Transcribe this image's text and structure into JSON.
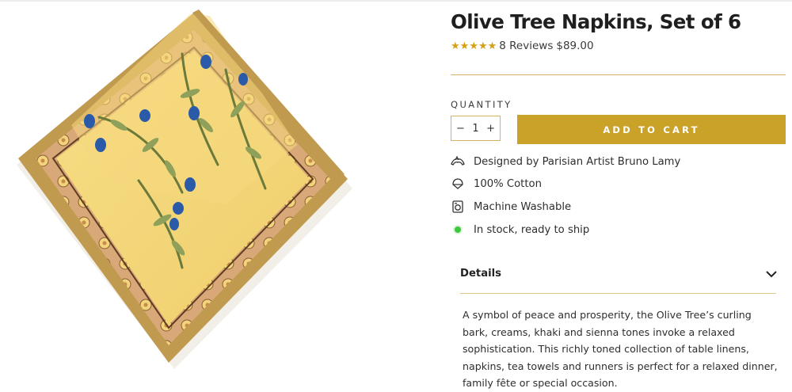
{
  "product": {
    "title": "Olive Tree Napkins, Set of 6",
    "rating_stars": 5,
    "reviews": "8 Reviews",
    "price": "$89.00",
    "image_icon": "napkin-product-image",
    "colors": {
      "accent": "#c9a227",
      "star": "#d4a017",
      "rule": "#d6b360",
      "in_stock": "#3bc93b"
    }
  },
  "purchase": {
    "quantity_label": "QUANTITY",
    "quantity_value": "1",
    "decrement": "−",
    "increment": "+",
    "add_to_cart": "ADD TO CART"
  },
  "features": [
    {
      "icon": "artist-hands-icon",
      "text": "Designed by Parisian Artist Bruno Lamy"
    },
    {
      "icon": "fabric-icon",
      "text": "100% Cotton"
    },
    {
      "icon": "washing-machine-icon",
      "text": "Machine Washable"
    },
    {
      "icon": "in-stock-dot-icon",
      "text": "In stock, ready to ship"
    }
  ],
  "details": {
    "label": "Details",
    "toggle_icon": "chevron-down-icon",
    "expanded": true,
    "description": "A symbol of peace and prosperity, the Olive Tree’s curling bark, creams, khaki and sienna tones invoke a relaxed sophistication. This richly toned collection of table linens, napkins, tea towels and runners is perfect for a relaxed dinner, family fête or special occasion."
  }
}
